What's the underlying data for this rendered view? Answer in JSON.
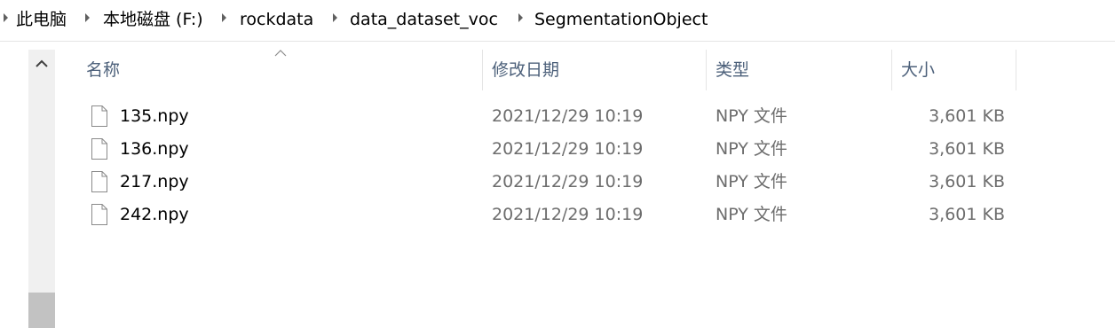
{
  "breadcrumb": {
    "items": [
      "此电脑",
      "本地磁盘 (F:)",
      "rockdata",
      "data_dataset_voc",
      "SegmentationObject"
    ]
  },
  "columns": {
    "name": "名称",
    "date": "修改日期",
    "type": "类型",
    "size": "大小"
  },
  "files": [
    {
      "name": "135.npy",
      "date": "2021/12/29 10:19",
      "type": "NPY 文件",
      "size": "3,601 KB"
    },
    {
      "name": "136.npy",
      "date": "2021/12/29 10:19",
      "type": "NPY 文件",
      "size": "3,601 KB"
    },
    {
      "name": "217.npy",
      "date": "2021/12/29 10:19",
      "type": "NPY 文件",
      "size": "3,601 KB"
    },
    {
      "name": "242.npy",
      "date": "2021/12/29 10:19",
      "type": "NPY 文件",
      "size": "3,601 KB"
    }
  ],
  "icons": {
    "breadcrumb_separator": "chevron-right-icon",
    "scroll_up": "chevron-up-icon",
    "sort": "sort-ascending-icon",
    "file": "file-icon"
  }
}
